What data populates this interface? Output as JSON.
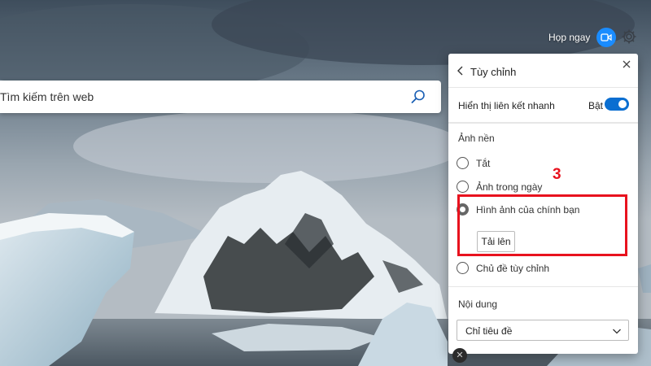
{
  "header": {
    "meet_now_label": "Họp ngay",
    "meet_icon": "video-camera-icon",
    "settings_icon": "gear-icon"
  },
  "search": {
    "placeholder": "Tìm kiếm trên web",
    "icon": "search-icon"
  },
  "customize_panel": {
    "title": "Tùy chỉnh",
    "quick_links": {
      "label": "Hiển thị liên kết nhanh",
      "state_label": "Bật",
      "enabled": true
    },
    "background": {
      "section_label": "Ảnh nền",
      "options": [
        {
          "label": "Tắt",
          "selected": false
        },
        {
          "label": "Ảnh trong ngày",
          "selected": false
        },
        {
          "label": "Hình ảnh của chính bạn",
          "selected": true
        },
        {
          "label": "Chủ đề tùy chỉnh",
          "selected": false
        }
      ],
      "upload_label": "Tải lên"
    },
    "content": {
      "section_label": "Nội dung",
      "selected_value": "Chỉ tiêu đề"
    }
  },
  "annotation": {
    "step_number": "3",
    "color": "#e8121e"
  },
  "colors": {
    "accent": "#0a6ed1",
    "meet_button": "#1a8cff"
  }
}
